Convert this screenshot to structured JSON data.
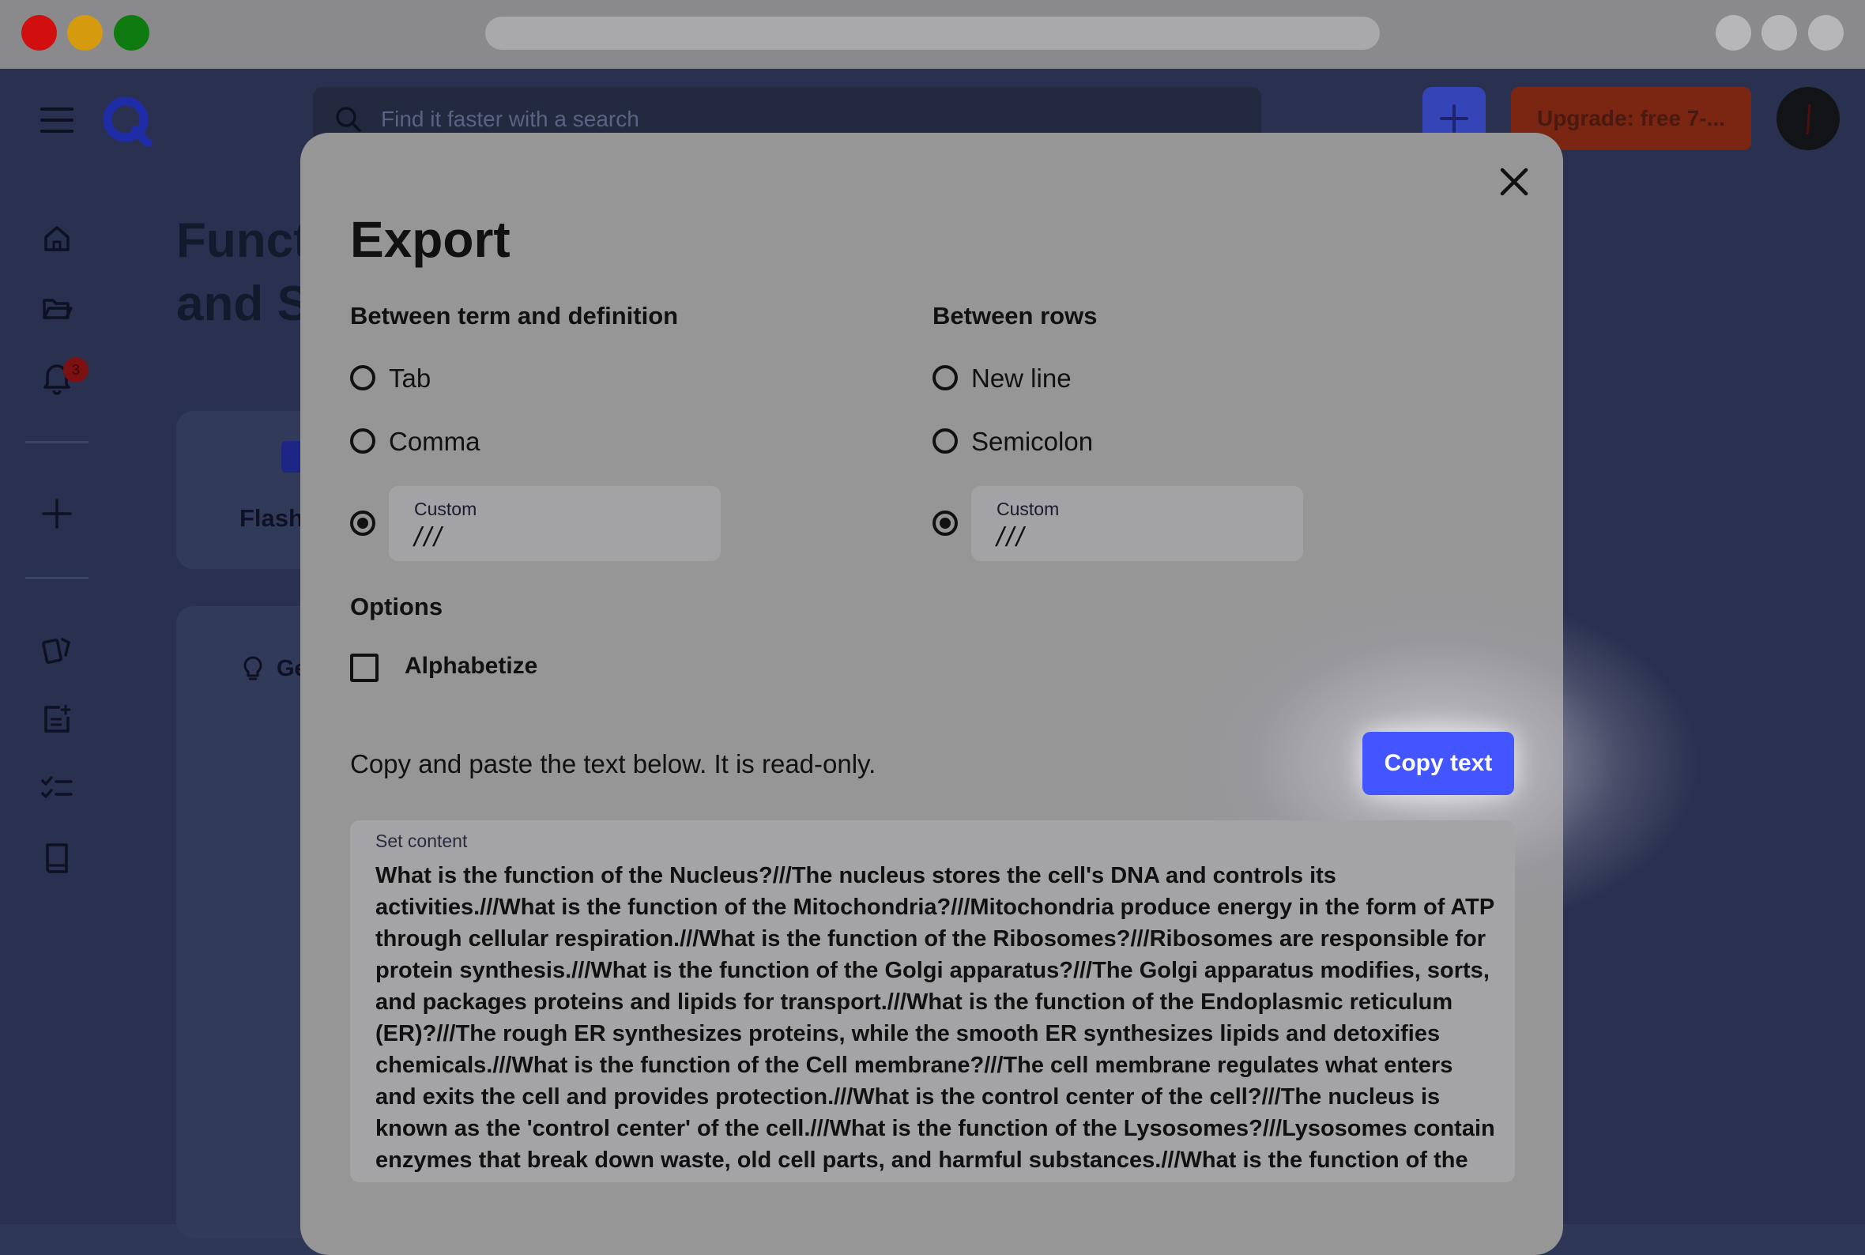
{
  "window": {
    "traffic_lights": [
      "#d20f0f",
      "#d59a0e",
      "#0f7a0f"
    ]
  },
  "header": {
    "search_placeholder": "Find it faster with a search",
    "upgrade_label": "Upgrade: free 7-..."
  },
  "sidebar": {
    "notification_count": "3"
  },
  "background": {
    "title_line1": "Funct",
    "title_line2": "and S",
    "card_label": "Flash",
    "card2_label": "Ge"
  },
  "modal": {
    "title": "Export",
    "term_def": {
      "heading": "Between term and definition",
      "options": [
        "Tab",
        "Comma"
      ],
      "custom_label": "Custom",
      "custom_value": "///",
      "selected": "Custom"
    },
    "rows": {
      "heading": "Between rows",
      "options": [
        "New line",
        "Semicolon"
      ],
      "custom_label": "Custom",
      "custom_value": "///",
      "selected": "Custom"
    },
    "options": {
      "heading": "Options",
      "alphabetize_label": "Alphabetize",
      "alphabetize_checked": false
    },
    "note": "Copy and paste the text below. It is read-only.",
    "copy_button": "Copy text",
    "content_label": "Set content",
    "content_text": "What is the function of the Nucleus?///The nucleus stores the cell's DNA and controls its activities.///What is the function of the Mitochondria?///Mitochondria produce energy in the form of ATP through cellular respiration.///What is the function of the Ribosomes?///Ribosomes are responsible for protein synthesis.///What is the function of the Golgi apparatus?///The Golgi apparatus modifies, sorts, and packages proteins and lipids for transport.///What is the function of the Endoplasmic reticulum (ER)?///The rough ER synthesizes proteins, while the smooth ER synthesizes lipids and detoxifies chemicals.///What is the function of the Cell membrane?///The cell membrane regulates what enters and exits the cell and provides protection.///What is the control center of the cell?///The nucleus is known as the 'control center' of the cell.///What is the function of the Lysosomes?///Lysosomes contain enzymes that break down waste, old cell parts, and harmful substances.///What is the function of the"
  },
  "colors": {
    "accent": "#4255ff",
    "modal_bg": "#969697",
    "app_bg": "#2a3150"
  }
}
